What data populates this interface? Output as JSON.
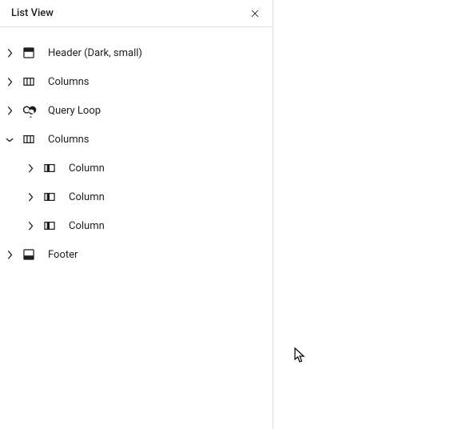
{
  "panel": {
    "title": "List View"
  },
  "tree": {
    "items": [
      {
        "label": "Header (Dark, small)",
        "icon": "header",
        "level": 0,
        "expanded": false
      },
      {
        "label": "Columns",
        "icon": "columns",
        "level": 0,
        "expanded": false
      },
      {
        "label": "Query Loop",
        "icon": "loop",
        "level": 0,
        "expanded": false
      },
      {
        "label": "Columns",
        "icon": "columns",
        "level": 0,
        "expanded": true
      },
      {
        "label": "Column",
        "icon": "column",
        "level": 1,
        "expanded": false
      },
      {
        "label": "Column",
        "icon": "column",
        "level": 1,
        "expanded": false
      },
      {
        "label": "Column",
        "icon": "column",
        "level": 1,
        "expanded": false
      },
      {
        "label": "Footer",
        "icon": "footer",
        "level": 0,
        "expanded": false
      }
    ]
  }
}
